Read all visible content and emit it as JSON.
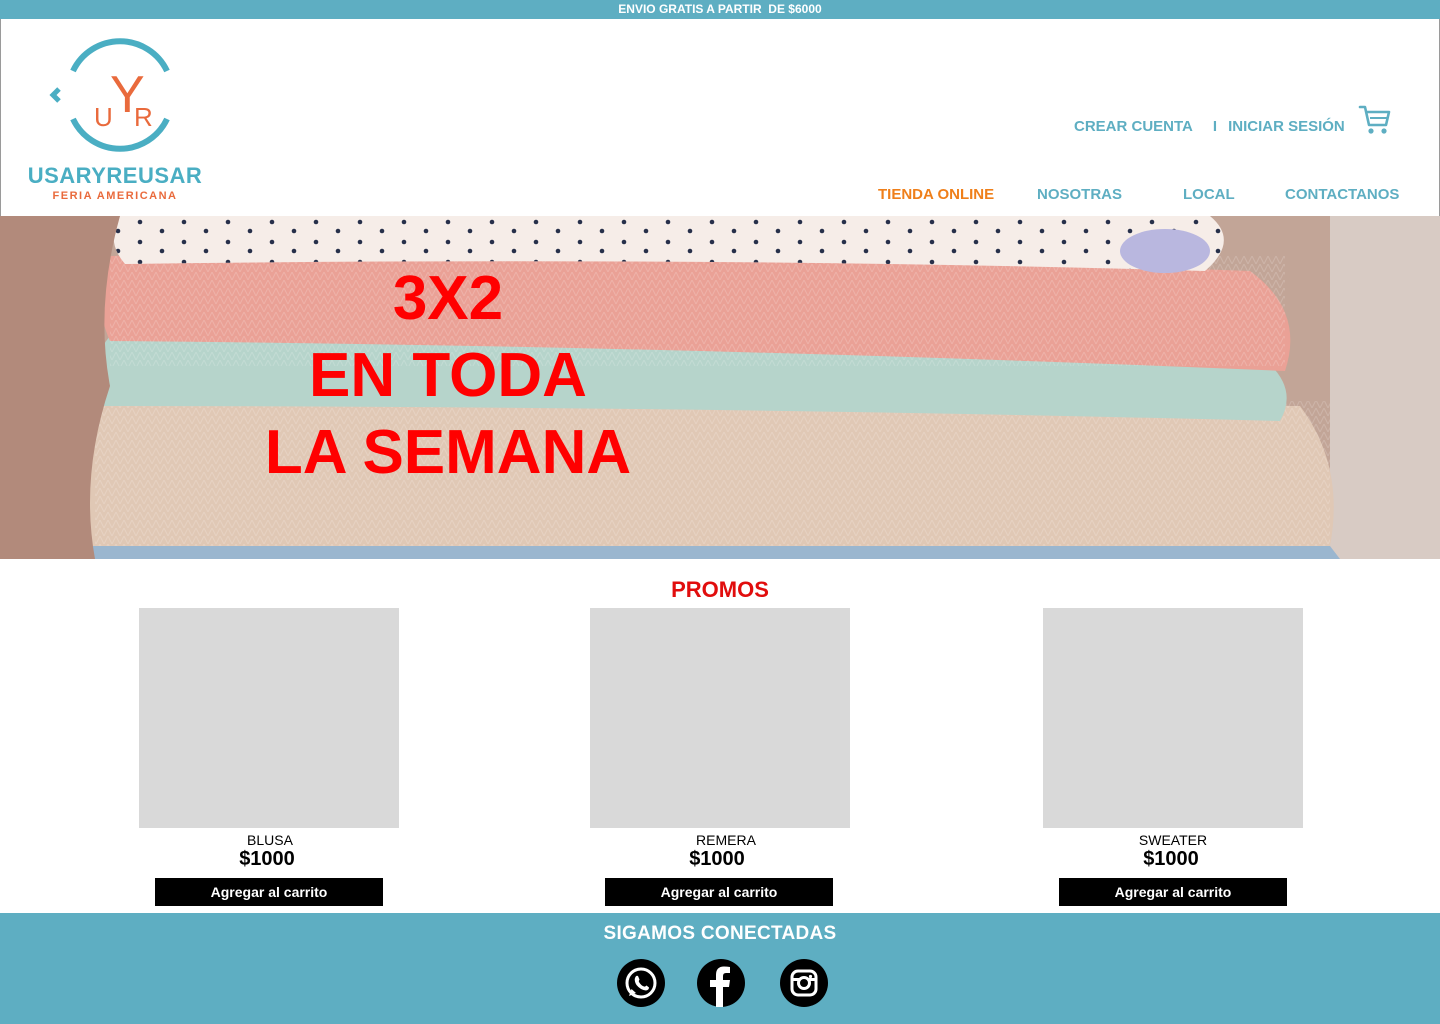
{
  "topbar": {
    "text": "ENVIO GRATIS A PARTIR  DE $6000"
  },
  "brand": {
    "monogram_left": "U",
    "monogram_center": "Y",
    "monogram_right": "R",
    "name": "USARYREUSAR",
    "subtitle": "FERIA AMERICANA",
    "color_primary": "#4aaec3",
    "color_accent": "#e96a3c"
  },
  "account": {
    "create": "CREAR CUENTA",
    "separator": "I",
    "login": "INICIAR SESIÓN",
    "cart_icon": "cart-icon"
  },
  "nav": {
    "items": [
      {
        "label": "TIENDA ONLINE",
        "active": true
      },
      {
        "label": "NOSOTRAS",
        "active": false
      },
      {
        "label": "LOCAL",
        "active": false
      },
      {
        "label": "CONTACTANOS",
        "active": false
      }
    ],
    "color_active": "#ef7f1a",
    "color_default": "#5eaec2"
  },
  "hero": {
    "line1": "3X2",
    "line2": "EN TODA",
    "line3": "LA SEMANA",
    "color": "#ff0000"
  },
  "promos": {
    "title": "PROMOS",
    "products": [
      {
        "name": "BLUSA",
        "price": "$1000",
        "button": "Agregar al carrito"
      },
      {
        "name": "REMERA",
        "price": "$1000",
        "button": "Agregar al carrito"
      },
      {
        "name": "SWEATER",
        "price": "$1000",
        "button": "Agregar al carrito"
      }
    ]
  },
  "footer": {
    "title": "SIGAMOS CONECTADAS",
    "social": [
      {
        "icon": "whatsapp-icon"
      },
      {
        "icon": "facebook-icon"
      },
      {
        "icon": "instagram-icon"
      }
    ],
    "color": "#5eaec2"
  }
}
